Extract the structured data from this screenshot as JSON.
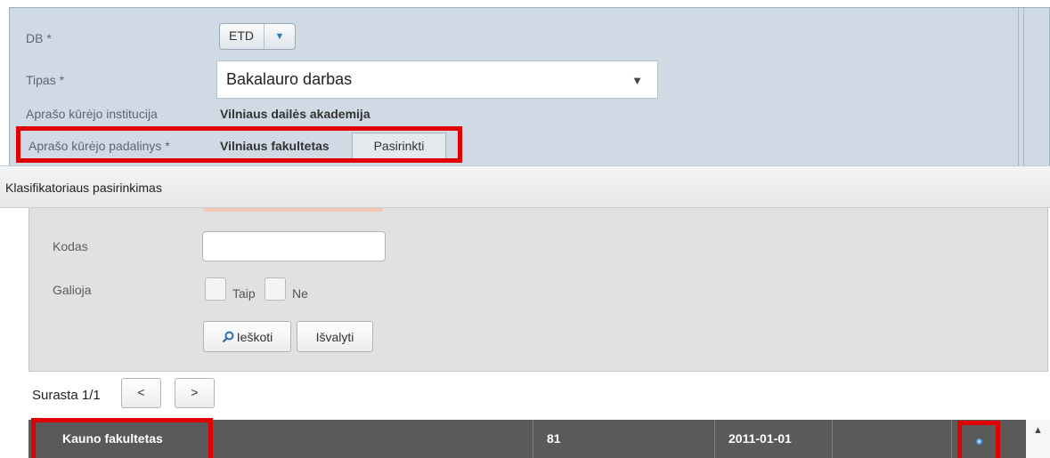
{
  "form": {
    "db_label": "DB *",
    "db_value": "ETD",
    "tipas_label": "Tipas *",
    "tipas_value": "Bakalauro darbas",
    "institucija_label": "Aprašo kūrėjo institucija",
    "institucija_value": "Vilniaus dailės akademija",
    "padalinys_label": "Aprašo kūrėjo padalinys *",
    "padalinys_value": "Vilniaus fakultetas",
    "pasirinkti_label": "Pasirinkti"
  },
  "dialog": {
    "title": "Klasifikatoriaus pasirinkimas",
    "kodas_label": "Kodas",
    "galioja_label": "Galioja",
    "taip_label": "Taip",
    "ne_label": "Ne",
    "search_label": "Ieškoti",
    "clear_label": "Išvalyti"
  },
  "pagination": {
    "label": "Surasta 1/1",
    "prev": "<",
    "next": ">"
  },
  "table": {
    "rows": [
      {
        "name": "Kauno fakultetas",
        "code": "81",
        "date": "2011-01-01",
        "extra": ""
      }
    ]
  },
  "icons": {
    "dropdown": "chevron-down-icon",
    "search": "search-icon",
    "select_row": "select-circle-icon",
    "scroll_up": "scroll-up-arrow-icon"
  },
  "colors": {
    "highlight": "#e00000",
    "form_bg": "#cfdae4",
    "row_bg": "#5a5a5a",
    "accent": "#3b78b0"
  }
}
